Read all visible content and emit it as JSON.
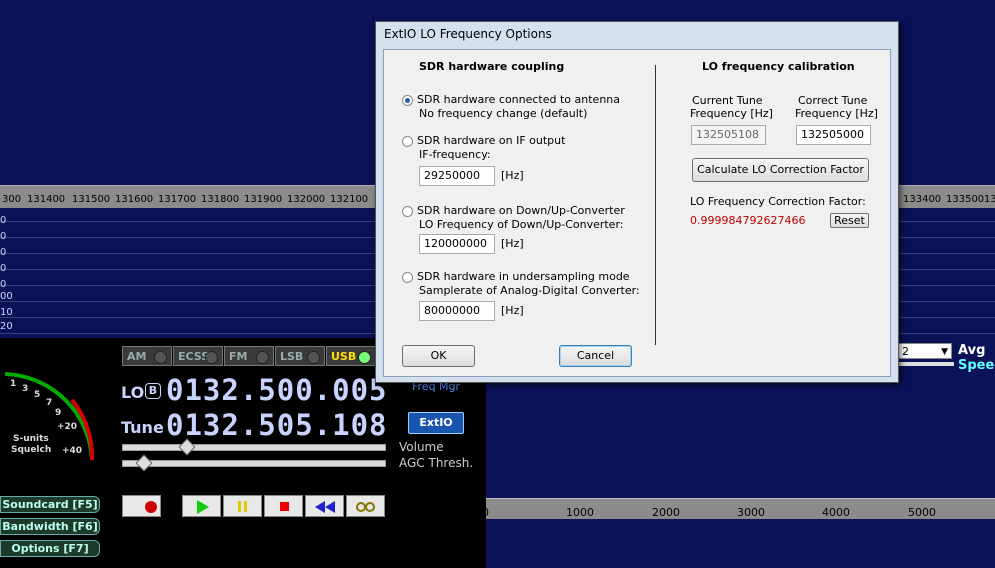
{
  "spectrum": {
    "ticks": [
      "300",
      "131400",
      "131500",
      "131600",
      "131700",
      "131800",
      "131900",
      "132000",
      "132100",
      "133400",
      "133500",
      "13"
    ],
    "db_labels": [
      "0",
      "0",
      "0",
      "0",
      "0",
      "00",
      "10",
      "20"
    ]
  },
  "modes": [
    {
      "label": "AM",
      "active": false
    },
    {
      "label": "ECSS",
      "active": false
    },
    {
      "label": "FM",
      "active": false
    },
    {
      "label": "LSB",
      "active": false
    },
    {
      "label": "USB",
      "active": true
    }
  ],
  "lo": {
    "label": "LO",
    "badge": "B",
    "value": "0132.500.005"
  },
  "tune": {
    "label": "Tune",
    "value": "0132.505.108"
  },
  "extio_label": "ExtIO",
  "freq_hint": "Freq Mgr",
  "volume_label": "Volume",
  "agc_label": "AGC Thresh.",
  "smeter": {
    "scale": [
      "1",
      "3",
      "5",
      "7",
      "9",
      "+20",
      "+40"
    ],
    "s_units": "S-units",
    "squelch": "Squelch"
  },
  "side_buttons": [
    {
      "label": "Soundcard  [F5]"
    },
    {
      "label": "Bandwidth  [F6]"
    },
    {
      "label": "Options   [F7]"
    }
  ],
  "audio_ruler": {
    "ticks": [
      "0",
      "1000",
      "2000",
      "3000",
      "4000",
      "5000"
    ]
  },
  "avg": {
    "select_value": "2",
    "label": "Avg",
    "speed": "Speed"
  },
  "dialog": {
    "title": "ExtIO LO Frequency Options",
    "left_title": "SDR hardware coupling",
    "right_title": "LO frequency calibration",
    "options": [
      {
        "line1": "SDR hardware connected to antenna",
        "line2": "No frequency change (default)",
        "checked": true
      },
      {
        "line1": "SDR hardware on IF output",
        "line2": "IF-frequency:",
        "value": "29250000",
        "unit": "[Hz]",
        "checked": false
      },
      {
        "line1": "SDR hardware on Down/Up-Converter",
        "line2": "LO Frequency of  Down/Up-Converter:",
        "value": "120000000",
        "unit": "[Hz]",
        "checked": false
      },
      {
        "line1": "SDR hardware in undersampling mode",
        "line2": "Samplerate of Analog-Digital Converter:",
        "value": "80000000",
        "unit": "[Hz]",
        "checked": false
      }
    ],
    "current_tune_label1": "Current Tune",
    "current_tune_label2": "Frequency [Hz]",
    "current_tune_value": "132505108",
    "correct_tune_label1": "Correct Tune",
    "correct_tune_label2": "Frequency [Hz]",
    "correct_tune_value": "132505000",
    "calc_button": "Calculate LO Correction Factor",
    "factor_label": "LO Frequency Correction Factor:",
    "factor_value": "0.999984792627466",
    "reset_button": "Reset",
    "ok_button": "OK",
    "cancel_button": "Cancel"
  },
  "colors": {
    "factor": "#c00000",
    "usb_text": "#ffe000",
    "bg": "#0b1257"
  }
}
